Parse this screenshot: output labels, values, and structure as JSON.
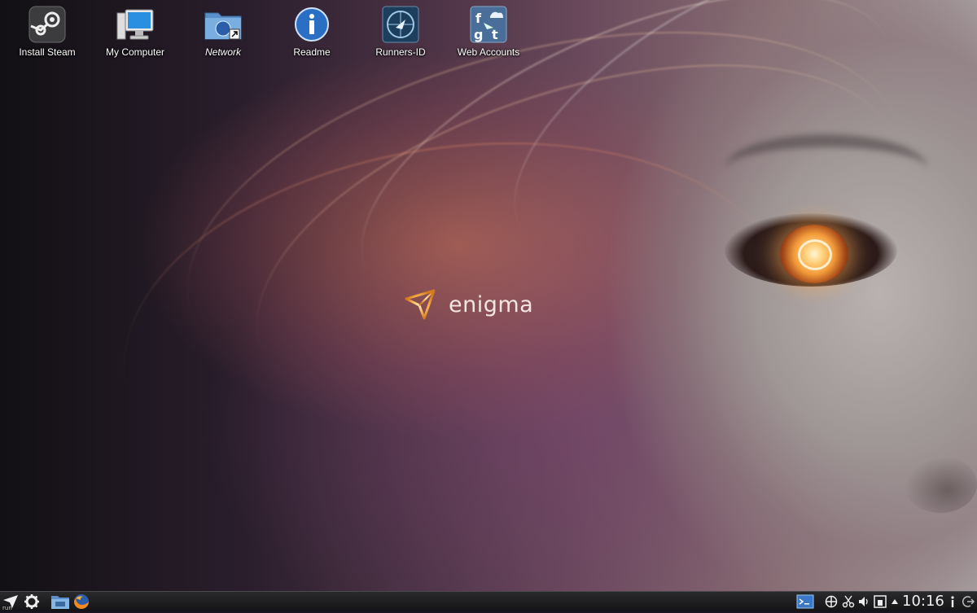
{
  "desktop": {
    "icons": [
      {
        "label": "Install Steam",
        "icon": "steam-icon"
      },
      {
        "label": "My Computer",
        "icon": "computer-icon"
      },
      {
        "label": "Network",
        "icon": "network-folder-icon"
      },
      {
        "label": "Readme",
        "icon": "info-icon"
      },
      {
        "label": "Runners-ID",
        "icon": "runners-id-icon"
      },
      {
        "label": "Web Accounts",
        "icon": "web-accounts-icon"
      }
    ]
  },
  "wallpaper": {
    "logo_text": "enigma"
  },
  "taskbar": {
    "launcher_label": "run",
    "clock": "10:16",
    "launchers": [
      "app-launcher-icon",
      "settings-gear-icon",
      "file-manager-icon",
      "firefox-icon"
    ],
    "tray": [
      "terminal-icon",
      "network-icon",
      "clipboard-scissors-icon",
      "volume-icon",
      "device-notifier-icon",
      "tray-expand-icon",
      "info-icon",
      "logout-icon"
    ]
  },
  "colors": {
    "accent_orange": "#f29a3a",
    "taskbar_bg": "#1e1e20",
    "icon_blue": "#2a6fc4"
  }
}
